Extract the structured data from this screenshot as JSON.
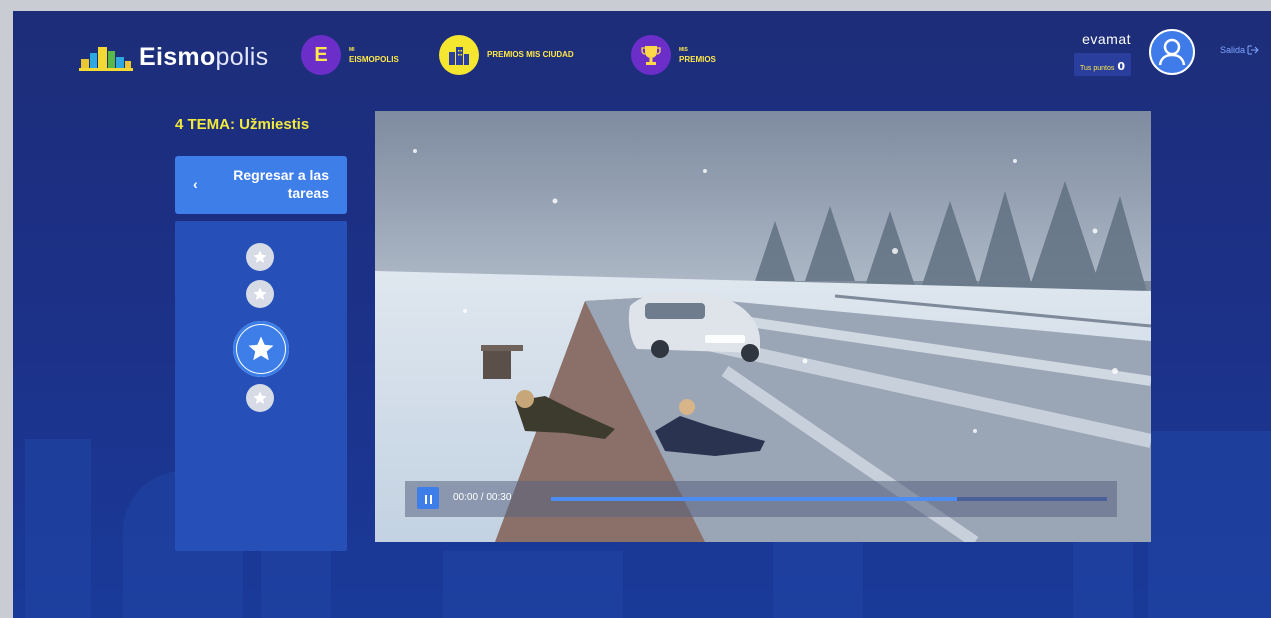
{
  "app": {
    "logo_bold": "Eismo",
    "logo_light": "polis"
  },
  "nav": [
    {
      "letter": "E",
      "line1": "MI",
      "line2": "EISMOPOLIS",
      "bg": "#6b2ec9",
      "fg": "#ffe94a",
      "icon": "letter-e-icon"
    },
    {
      "line1": "",
      "line2": "PREMIOS MIS CIUDAD",
      "bg": "#f5e630",
      "fg": "#2c3f9e",
      "icon": "city-buildings-icon"
    },
    {
      "line1": "MIS",
      "line2": "PREMIOS",
      "bg": "#6b2ec9",
      "fg": "#ffd84a",
      "icon": "trophy-icon"
    }
  ],
  "user": {
    "name": "evamat",
    "points_label": "Tus puntos",
    "points_value": "0",
    "logout_label": "Salida"
  },
  "topic": {
    "title": "4 TEMA: Užmiestis"
  },
  "sidebar": {
    "back_label": "Regresar a las tareas",
    "steps": [
      {
        "state": "inactive"
      },
      {
        "state": "inactive"
      },
      {
        "state": "active"
      },
      {
        "state": "inactive"
      }
    ]
  },
  "video": {
    "time": "00:00 / 00:30",
    "progress": 0.73
  },
  "colors": {
    "accent": "#3d7ee8",
    "highlight": "#f1e93c",
    "background": "#1c3086"
  }
}
